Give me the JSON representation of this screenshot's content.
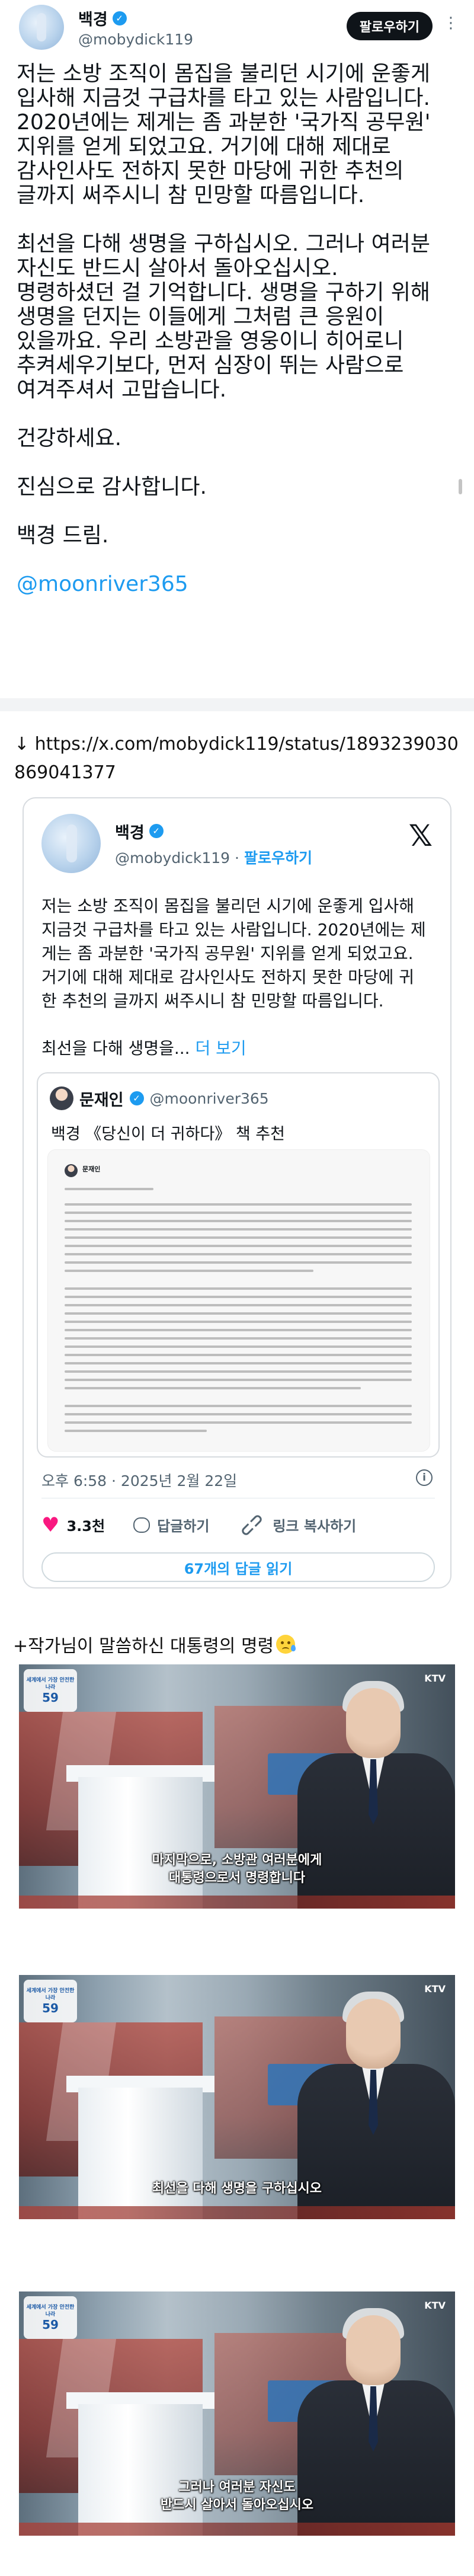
{
  "tweet": {
    "author_name": "백경",
    "author_handle": "@mobydick119",
    "follow_label": "팔로우하기",
    "more_label": "⋮",
    "paragraphs": [
      [
        "저는 소방 조직이 몸집을 불리던 시기에 운좋게",
        "입사해 지금것 구급차를 타고 있는 사람입니다.",
        "2020년에는 제게는 좀 과분한 '국가직 공무원'",
        "지위를 얻게 되었고요. 거기에 대해 제대로",
        "감사인사도 전하지 못한 마당에 귀한 추천의",
        "글까지 써주시니 참 민망할 따름입니다."
      ],
      [
        "최선을 다해 생명을 구하십시오. 그러나 여러분",
        "자신도 반드시 살아서 돌아오십시오.",
        "명령하셨던 걸 기억합니다. 생명을 구하기 위해",
        "생명을 던지는 이들에게 그처럼 큰 응원이",
        "있을까요. 우리 소방관을 영웅이니 히어로니",
        "추켜세우기보다, 먼저 심장이 뛰는 사람으로",
        "여겨주셔서 고맙습니다."
      ],
      [
        "건강하세요."
      ],
      [
        "진심으로 감사합니다."
      ],
      [
        "백경 드림."
      ]
    ],
    "mention": "@moonriver365"
  },
  "link": {
    "text": "↓ https://x.com/mobydick119/status/1893239030869041377"
  },
  "embed": {
    "author_name": "백경",
    "author_handle": "@mobydick119",
    "separator": "·",
    "follow_label": "팔로우하기",
    "x_logo": "𝕏",
    "text_lines": [
      "저는 소방 조직이 몸집을 불리던 시기에 운좋게 입사해",
      "지금것 구급차를 타고 있는 사람입니다. 2020년에는 제",
      "게는 좀 과분한 '국가직 공무원' 지위를 얻게 되었고요.",
      "거기에 대해 제대로 감사인사도 전하지 못한 마당에 귀",
      "한 추천의 글까지 써주시니 참 민망할 따름입니다."
    ],
    "truncated_text": "최선을 다해 생명을...",
    "more_label": "더 보기",
    "quote": {
      "author_name": "문재인",
      "author_handle": "@moonriver365",
      "text": "백경 《당신이 더 귀하다》 책 추천",
      "doc_name": "문재인"
    },
    "timestamp": "오후 6:58 · 2025년 2월 22일",
    "info_icon": "i",
    "likes": "3.3천",
    "reply_label": "답글하기",
    "copy_link_label": "링크 복사하기",
    "replies_button": "67개의 답글 읽기"
  },
  "caption": {
    "text": "+작가님이 말씀하신 대통령의 명령"
  },
  "frames": [
    {
      "line1": "마지막으로, 소방관 여러분에게",
      "line2": "대통령으로서 명령합니다",
      "badge_top": "세계에서 가장 안전한 나라",
      "badge_num": "59"
    },
    {
      "line1": "최선을 다해 생명을 구하십시오",
      "line2": "",
      "badge_top": "세계에서 가장 안전한 나라",
      "badge_num": "59"
    },
    {
      "line1": "그러나 여러분 자신도",
      "line2": "반드시 살아서 돌아오십시오",
      "badge_top": "세계에서 가장 안전한 나라",
      "badge_num": "59"
    }
  ],
  "frame_channel": "KTV",
  "colors": {
    "accent": "#1d9bf0",
    "like": "#f91880",
    "text": "#0f1419",
    "secondary": "#536471"
  }
}
